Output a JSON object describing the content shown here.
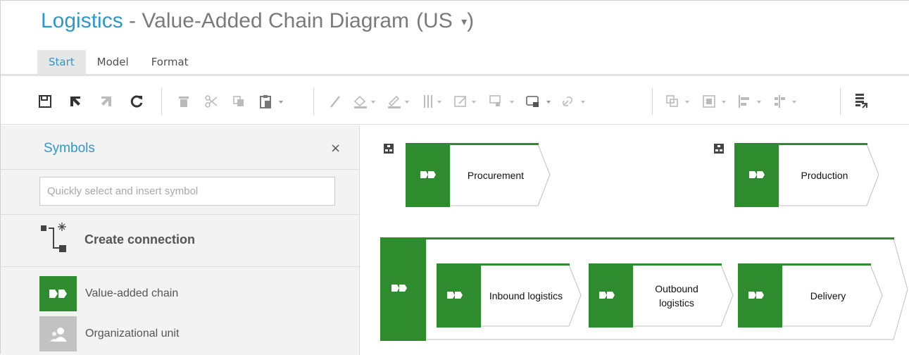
{
  "header": {
    "app_name": "Logistics",
    "separator": " - ",
    "document_title": "Value-Added Chain Diagram",
    "language": "(US",
    "language_caret": "▾",
    "language_close": ")"
  },
  "tabs": [
    {
      "label": "Start",
      "active": true
    },
    {
      "label": "Model",
      "active": false
    },
    {
      "label": "Format",
      "active": false
    }
  ],
  "toolbar": {
    "icons": [
      "save-icon",
      "undo-icon",
      "redo-icon",
      "refresh-icon",
      "delete-icon",
      "cut-icon",
      "copy-icon",
      "paste-icon",
      "format-painter-icon",
      "fill-color-icon",
      "line-color-icon",
      "line-style-icon",
      "edit-attributes-icon",
      "shape-icon",
      "connection-icon",
      "link-icon",
      "arrange-icon",
      "group-icon",
      "align-icon",
      "distribute-icon",
      "export-icon"
    ]
  },
  "sidebar": {
    "title": "Symbols",
    "close": "×",
    "search_placeholder": "Quickly select and insert symbol",
    "create_connection": "Create connection",
    "items": [
      {
        "label": "Value-added chain",
        "icon": "value-added-chain-icon"
      },
      {
        "label": "Organizational unit",
        "icon": "organizational-unit-icon"
      }
    ]
  },
  "diagram": {
    "shapes": [
      {
        "label": "Procurement"
      },
      {
        "label": "Production"
      },
      {
        "label": "Inbound logistics"
      },
      {
        "label": "Outbound logistics"
      },
      {
        "label": "Delivery"
      }
    ]
  },
  "colors": {
    "accent_blue": "#2f97c9",
    "vac_green": "#2e8b2e",
    "tab_active_bg": "#e6e6e6"
  }
}
